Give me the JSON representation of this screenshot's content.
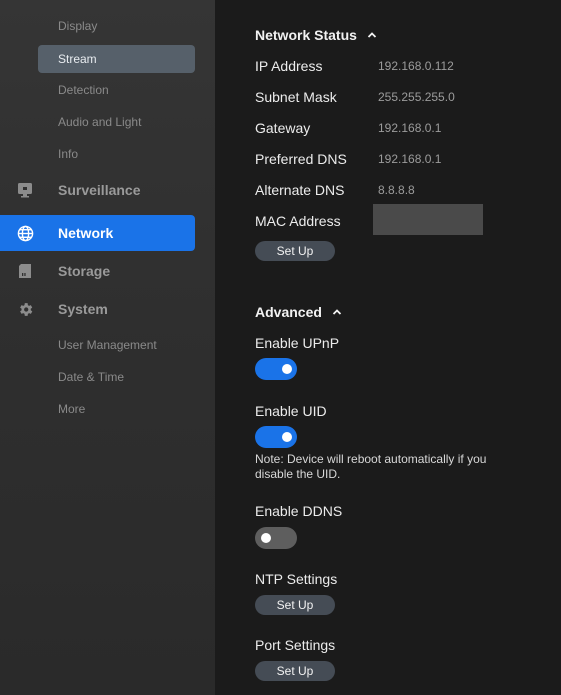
{
  "sidebar": {
    "sub_top": [
      "Display",
      "Stream",
      "Detection",
      "Audio and Light",
      "Info"
    ],
    "surveillance": "Surveillance",
    "network": "Network",
    "storage": "Storage",
    "system": "System",
    "sub_bottom": [
      "User Management",
      "Date & Time",
      "More"
    ],
    "icons": {
      "surveillance": "monitor-icon",
      "network": "globe-icon",
      "storage": "sd-card-icon",
      "system": "gear-icon"
    },
    "active_color": "#1a73e8"
  },
  "network_status": {
    "title": "Network Status",
    "rows": [
      {
        "label": "IP Address",
        "value": "192.168.0.112"
      },
      {
        "label": "Subnet Mask",
        "value": "255.255.255.0"
      },
      {
        "label": "Gateway",
        "value": "192.168.0.1"
      },
      {
        "label": "Preferred DNS",
        "value": "192.168.0.1"
      },
      {
        "label": "Alternate DNS",
        "value": "8.8.8.8"
      },
      {
        "label": "MAC Address",
        "value": ""
      }
    ],
    "setup_label": "Set Up"
  },
  "advanced": {
    "title": "Advanced",
    "upnp": {
      "label": "Enable UPnP",
      "on": true
    },
    "uid": {
      "label": "Enable UID",
      "on": true,
      "note": "Note: Device will reboot automatically if you disable the UID."
    },
    "ddns": {
      "label": "Enable DDNS",
      "on": false
    },
    "ntp": {
      "label": "NTP Settings",
      "button": "Set Up"
    },
    "port": {
      "label": "Port Settings",
      "button": "Set Up"
    }
  }
}
